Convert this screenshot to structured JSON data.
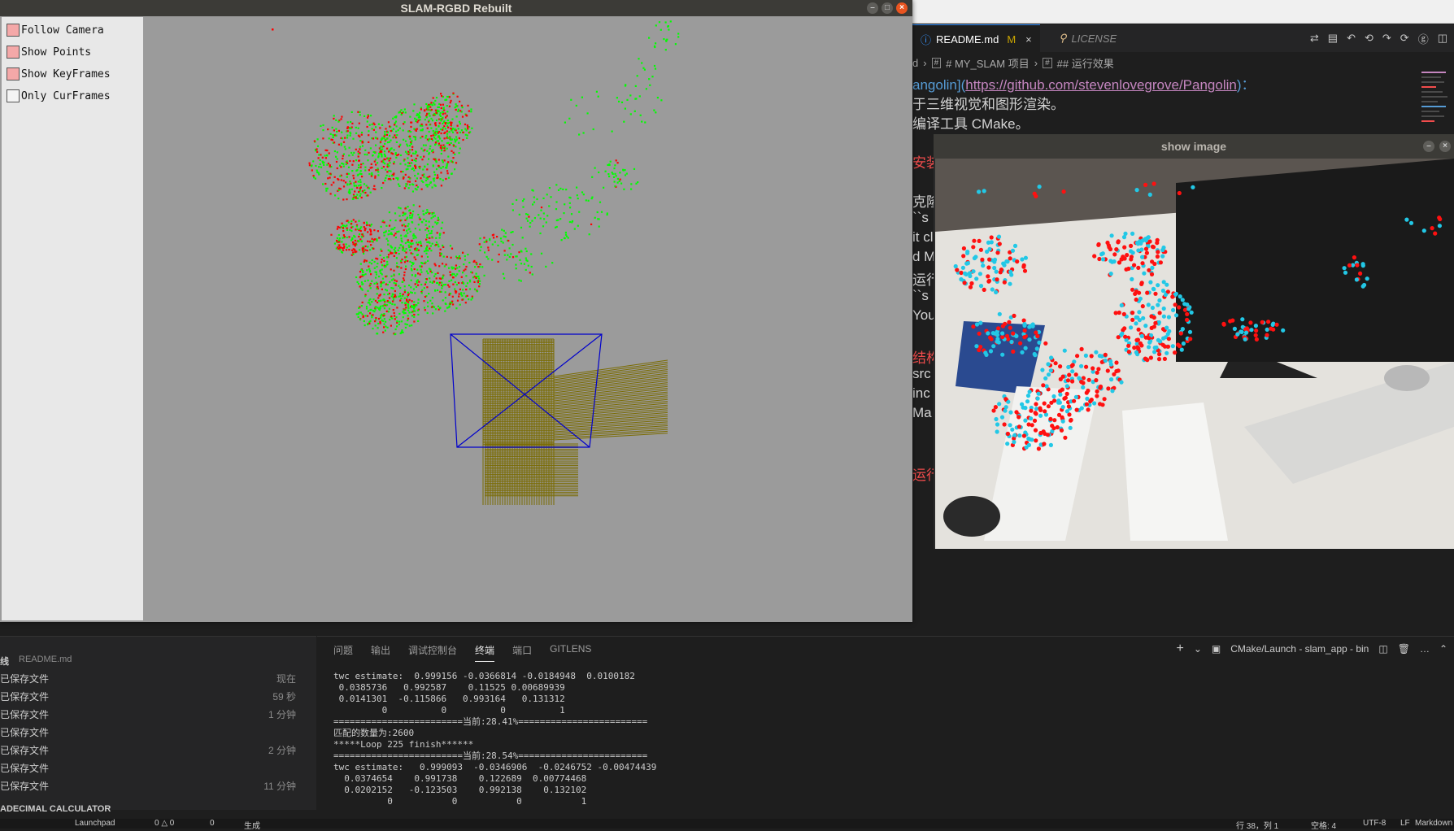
{
  "slam_window": {
    "title": "SLAM-RGBD Rebuilt",
    "checkboxes": [
      {
        "label": "Follow Camera",
        "checked": true
      },
      {
        "label": "Show Points",
        "checked": true
      },
      {
        "label": "Show KeyFrames",
        "checked": true
      },
      {
        "label": "Only CurFrames",
        "checked": false
      }
    ],
    "colors": {
      "map_points_green": "#00ff00",
      "map_points_red": "#ff0000",
      "camera_frustum": "#0000cc",
      "keyframes": "#7a6b00"
    }
  },
  "image_window": {
    "title": "show image",
    "colors": {
      "features_cyan": "#22c8e6",
      "features_red": "#ff1010"
    }
  },
  "editor": {
    "tabs": [
      {
        "label": "README.md",
        "badge": "M",
        "icon": "info-icon",
        "active": true
      },
      {
        "label": "LICENSE",
        "icon": "license-icon",
        "active": false
      }
    ],
    "breadcrumb": [
      "d",
      "# MY_SLAM 项目",
      "## 运行效果"
    ],
    "lines": {
      "l1_bracket_open": "angolin]",
      "l1_link": "https://github.com/stevenlovegrove/Pangolin",
      "l1_end": ")：",
      "l2": "于三维视觉和图形渲染。",
      "l3": "编译工具 CMake。",
      "l4": "安装",
      "l5": "克隆",
      "l6": "``s",
      "l7": "it cl",
      "l8": "d M",
      "l9": "运行",
      "l10": "``s",
      "l11": "You",
      "l12": "结构",
      "l13": "src",
      "l14": "inc",
      "l15": "Ma",
      "l16": "运行"
    }
  },
  "panel": {
    "tabs": [
      "问题",
      "输出",
      "调试控制台",
      "终端",
      "端口",
      "GITLENS"
    ],
    "active_tab": "终端",
    "terminal_name": "CMake/Launch - slam_app - bin",
    "terminal_lines": [
      "twc estimate:  0.999156 -0.0366814 -0.0184948  0.0100182",
      " 0.0385736   0.992587    0.11525 0.00689939",
      " 0.0141301  -0.115866   0.993164   0.131312",
      "         0          0          0          1",
      "========================当前:28.41%========================",
      "匹配的数量为:2600",
      "*****Loop 225 finish******",
      "========================当前:28.54%========================",
      "twc estimate:   0.999093  -0.0346906  -0.0246752 -0.00474439",
      "  0.0374654    0.991738    0.122689  0.00774468",
      "  0.0202152   -0.123503    0.992138    0.132102",
      "          0           0           0           1"
    ]
  },
  "timeline": {
    "header_label": "线",
    "header_file": "README.md",
    "rows": [
      {
        "label": "已保存文件",
        "time": "现在"
      },
      {
        "label": "已保存文件",
        "time": "59 秒"
      },
      {
        "label": "已保存文件",
        "time": "1 分钟"
      },
      {
        "label": "已保存文件",
        "time": ""
      },
      {
        "label": "已保存文件",
        "time": "2 分钟"
      },
      {
        "label": "已保存文件",
        "time": ""
      },
      {
        "label": "已保存文件",
        "time": "11 分钟"
      }
    ],
    "calculator_title": "ADECIMAL CALCULATOR"
  },
  "statusbar": {
    "launchpad": "Launchpad",
    "problems": "0 △ 0",
    "warnings": "0",
    "build": "生成",
    "line_col": "行 38，列 1",
    "spaces": "空格: 4",
    "encoding": "UTF-8",
    "eol": "LF",
    "language": "Markdown"
  }
}
